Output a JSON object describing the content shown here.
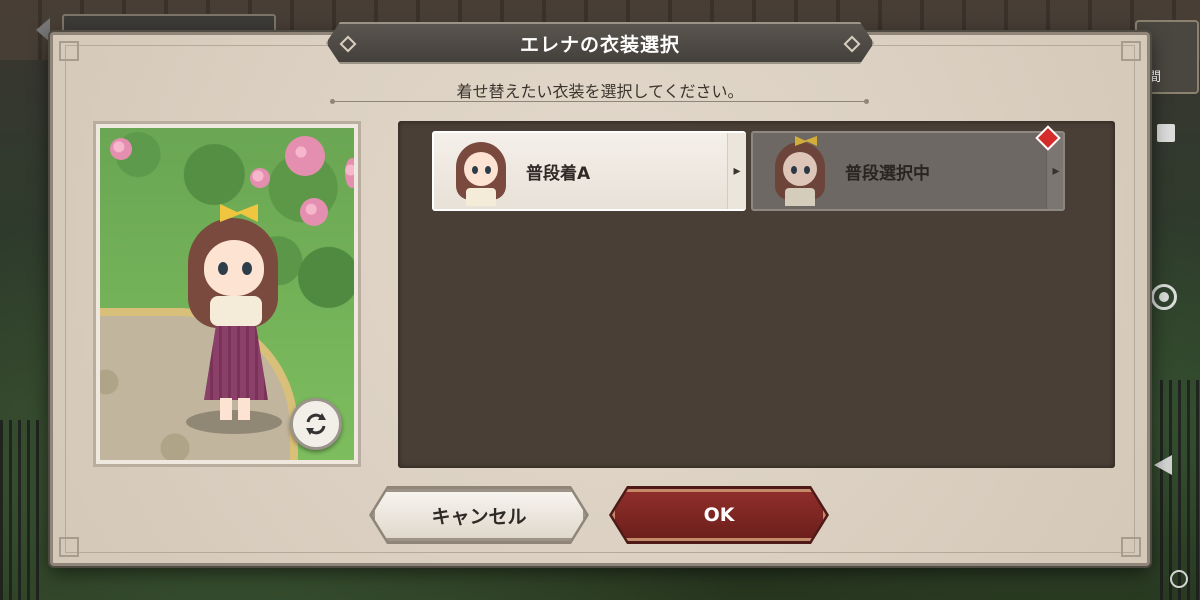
{
  "dialog": {
    "title": "エレナの衣装選択",
    "instruction": "着せ替えたい衣装を選択してください。"
  },
  "outfits": [
    {
      "label": "普段着A",
      "selected": false,
      "new_badge": false
    },
    {
      "label": "普段選択中",
      "selected": true,
      "new_badge": true
    }
  ],
  "buttons": {
    "cancel_label": "キャンセル",
    "ok_label": "OK"
  },
  "top_right": {
    "label": "間"
  },
  "icons": {
    "swap": "rotate-arrows-icon",
    "card_arrow": "chevron-right-icon",
    "new_badge": "red-diamond-badge-icon"
  },
  "colors": {
    "ok_button": "#7a2420",
    "panel": "#4a3f36",
    "dialog_bg": "#d9cfc2",
    "new_badge": "#d42b2b"
  }
}
